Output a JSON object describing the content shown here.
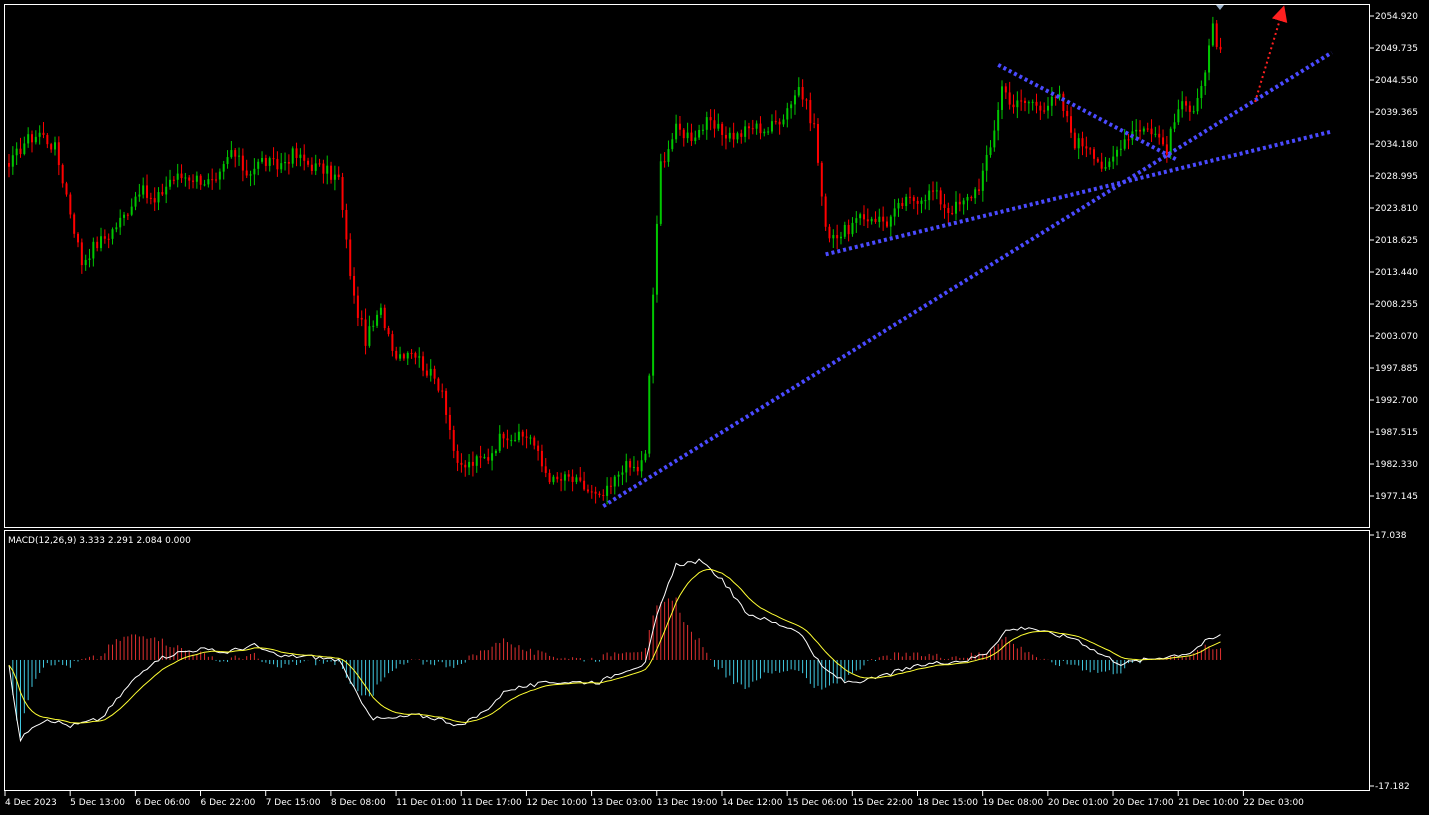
{
  "colors": {
    "background": "#000000",
    "border": "#ffffff",
    "bull_candle": "#00c800",
    "bear_candle": "#ff0000",
    "trendline": "#4a4aff",
    "arrow": "#ff2020",
    "macd_line": "#ffffff",
    "signal_line": "#ffff33",
    "hist_positive": "#e03030",
    "hist_negative": "#40c8e0"
  },
  "chart_data": [
    {
      "type": "candlestick",
      "title": "",
      "ylim": [
        1972.4,
        2057.9
      ],
      "grid": false,
      "y_ticks": [
        "2054.920",
        "2049.735",
        "2044.550",
        "2039.365",
        "2034.180",
        "2028.995",
        "2023.810",
        "2018.625",
        "2013.440",
        "2008.255",
        "2003.070",
        "1997.885",
        "1992.700",
        "1987.515",
        "1982.330",
        "1977.145"
      ],
      "x_ticks": [
        "4 Dec 2023",
        "5 Dec 13:00",
        "6 Dec 06:00",
        "6 Dec 22:00",
        "7 Dec 15:00",
        "8 Dec 08:00",
        "11 Dec 01:00",
        "11 Dec 17:00",
        "12 Dec 10:00",
        "13 Dec 03:00",
        "13 Dec 19:00",
        "14 Dec 12:00",
        "15 Dec 06:00",
        "15 Dec 22:00",
        "18 Dec 15:00",
        "19 Dec 08:00",
        "20 Dec 01:00",
        "20 Dec 17:00",
        "21 Dec 10:00",
        "22 Dec 03:00"
      ],
      "bars_per_tick": 17,
      "close_anchors": [
        [
          0,
          2030.5
        ],
        [
          4,
          2034.5
        ],
        [
          8,
          2036.0
        ],
        [
          12,
          2033.5
        ],
        [
          15,
          2026.0
        ],
        [
          19,
          2015.0
        ],
        [
          22,
          2017.5
        ],
        [
          26,
          2019.5
        ],
        [
          30,
          2022.5
        ],
        [
          34,
          2027.0
        ],
        [
          38,
          2024.5
        ],
        [
          42,
          2028.5
        ],
        [
          46,
          2029.0
        ],
        [
          50,
          2028.5
        ],
        [
          54,
          2027.5
        ],
        [
          58,
          2033.0
        ],
        [
          62,
          2029.5
        ],
        [
          66,
          2031.5
        ],
        [
          70,
          2030.5
        ],
        [
          74,
          2032.5
        ],
        [
          78,
          2031.0
        ],
        [
          82,
          2030.0
        ],
        [
          86,
          2028.5
        ],
        [
          88,
          2018.0
        ],
        [
          90,
          2009.0
        ],
        [
          93,
          2002.5
        ],
        [
          97,
          2007.0
        ],
        [
          101,
          2000.0
        ],
        [
          105,
          2001.0
        ],
        [
          109,
          1997.5
        ],
        [
          113,
          1994.5
        ],
        [
          117,
          1981.5
        ],
        [
          121,
          1982.5
        ],
        [
          125,
          1983.5
        ],
        [
          129,
          1987.5
        ],
        [
          133,
          1986.5
        ],
        [
          136,
          1987.0
        ],
        [
          139,
          1982.0
        ],
        [
          142,
          1979.5
        ],
        [
          146,
          1980.0
        ],
        [
          150,
          1978.5
        ],
        [
          154,
          1976.5
        ],
        [
          157,
          1978.5
        ],
        [
          160,
          1982.0
        ],
        [
          164,
          1981.5
        ],
        [
          166,
          1983.5
        ],
        [
          168,
          2010.0
        ],
        [
          170,
          2031.0
        ],
        [
          174,
          2036.5
        ],
        [
          178,
          2035.5
        ],
        [
          182,
          2037.5
        ],
        [
          186,
          2036.0
        ],
        [
          190,
          2035.5
        ],
        [
          194,
          2037.0
        ],
        [
          198,
          2036.5
        ],
        [
          202,
          2039.0
        ],
        [
          206,
          2043.5
        ],
        [
          210,
          2037.0
        ],
        [
          213,
          2020.0
        ],
        [
          217,
          2019.5
        ],
        [
          221,
          2021.5
        ],
        [
          225,
          2022.5
        ],
        [
          229,
          2021.5
        ],
        [
          233,
          2024.5
        ],
        [
          237,
          2025.5
        ],
        [
          241,
          2026.5
        ],
        [
          245,
          2023.5
        ],
        [
          249,
          2024.5
        ],
        [
          253,
          2027.5
        ],
        [
          256,
          2033.5
        ],
        [
          259,
          2043.5
        ],
        [
          262,
          2040.5
        ],
        [
          266,
          2041.0
        ],
        [
          270,
          2040.5
        ],
        [
          274,
          2041.5
        ],
        [
          278,
          2034.5
        ],
        [
          282,
          2034.0
        ],
        [
          286,
          2029.5
        ],
        [
          290,
          2034.5
        ],
        [
          294,
          2037.0
        ],
        [
          298,
          2036.5
        ],
        [
          302,
          2033.5
        ],
        [
          305,
          2040.0
        ],
        [
          309,
          2040.5
        ],
        [
          312,
          2045.5
        ],
        [
          314,
          2053.0
        ],
        [
          316,
          2048.5
        ]
      ],
      "annotations": [
        {
          "type": "trendline",
          "from": [
            155,
            1975.5
          ],
          "to": [
            345,
            2049.0
          ],
          "color": "#4a4aff"
        },
        {
          "type": "trendline",
          "from": [
            213,
            2016.3
          ],
          "to": [
            345,
            2036.2
          ],
          "color": "#4a4aff"
        },
        {
          "type": "trendline",
          "from": [
            258,
            2047.0
          ],
          "to": [
            305,
            2031.5
          ],
          "color": "#4a4aff"
        },
        {
          "type": "arrow",
          "from": [
            325,
            2041.0
          ],
          "to": [
            332,
            2055.4
          ],
          "color": "#ff2020"
        }
      ]
    },
    {
      "type": "macd",
      "label": "MACD(12,26,9) 3.333 2.291 2.084 0.000",
      "ylim": [
        -17.182,
        17.038
      ],
      "y_ticks": [
        "17.038",
        "-17.182"
      ],
      "macd_anchors": [
        [
          0,
          -1.0
        ],
        [
          3,
          -11.0
        ],
        [
          6,
          -9.0
        ],
        [
          10,
          -8.0
        ],
        [
          16,
          -9.0
        ],
        [
          24,
          -8.0
        ],
        [
          32,
          -3.0
        ],
        [
          38,
          0.0
        ],
        [
          44,
          1.0
        ],
        [
          50,
          1.5
        ],
        [
          56,
          1.0
        ],
        [
          64,
          2.0
        ],
        [
          70,
          0.5
        ],
        [
          78,
          0.5
        ],
        [
          86,
          0.0
        ],
        [
          90,
          -4.0
        ],
        [
          95,
          -8.0
        ],
        [
          100,
          -8.0
        ],
        [
          106,
          -7.5
        ],
        [
          112,
          -8.0
        ],
        [
          118,
          -9.0
        ],
        [
          124,
          -7.0
        ],
        [
          130,
          -4.0
        ],
        [
          136,
          -3.5
        ],
        [
          142,
          -3.0
        ],
        [
          148,
          -3.0
        ],
        [
          154,
          -3.0
        ],
        [
          160,
          -1.5
        ],
        [
          166,
          -0.5
        ],
        [
          169,
          6.0
        ],
        [
          174,
          13.0
        ],
        [
          180,
          13.5
        ],
        [
          186,
          11.0
        ],
        [
          192,
          6.5
        ],
        [
          200,
          5.0
        ],
        [
          206,
          4.0
        ],
        [
          212,
          -1.0
        ],
        [
          218,
          -3.0
        ],
        [
          224,
          -2.8
        ],
        [
          232,
          -1.5
        ],
        [
          240,
          -0.5
        ],
        [
          250,
          0.0
        ],
        [
          255,
          1.0
        ],
        [
          260,
          4.0
        ],
        [
          266,
          4.5
        ],
        [
          272,
          3.5
        ],
        [
          278,
          3.0
        ],
        [
          284,
          1.0
        ],
        [
          290,
          -0.5
        ],
        [
          296,
          0.0
        ],
        [
          302,
          0.5
        ],
        [
          308,
          1.0
        ],
        [
          312,
          2.5
        ],
        [
          316,
          3.33
        ]
      ],
      "signal_period": 9
    }
  ]
}
